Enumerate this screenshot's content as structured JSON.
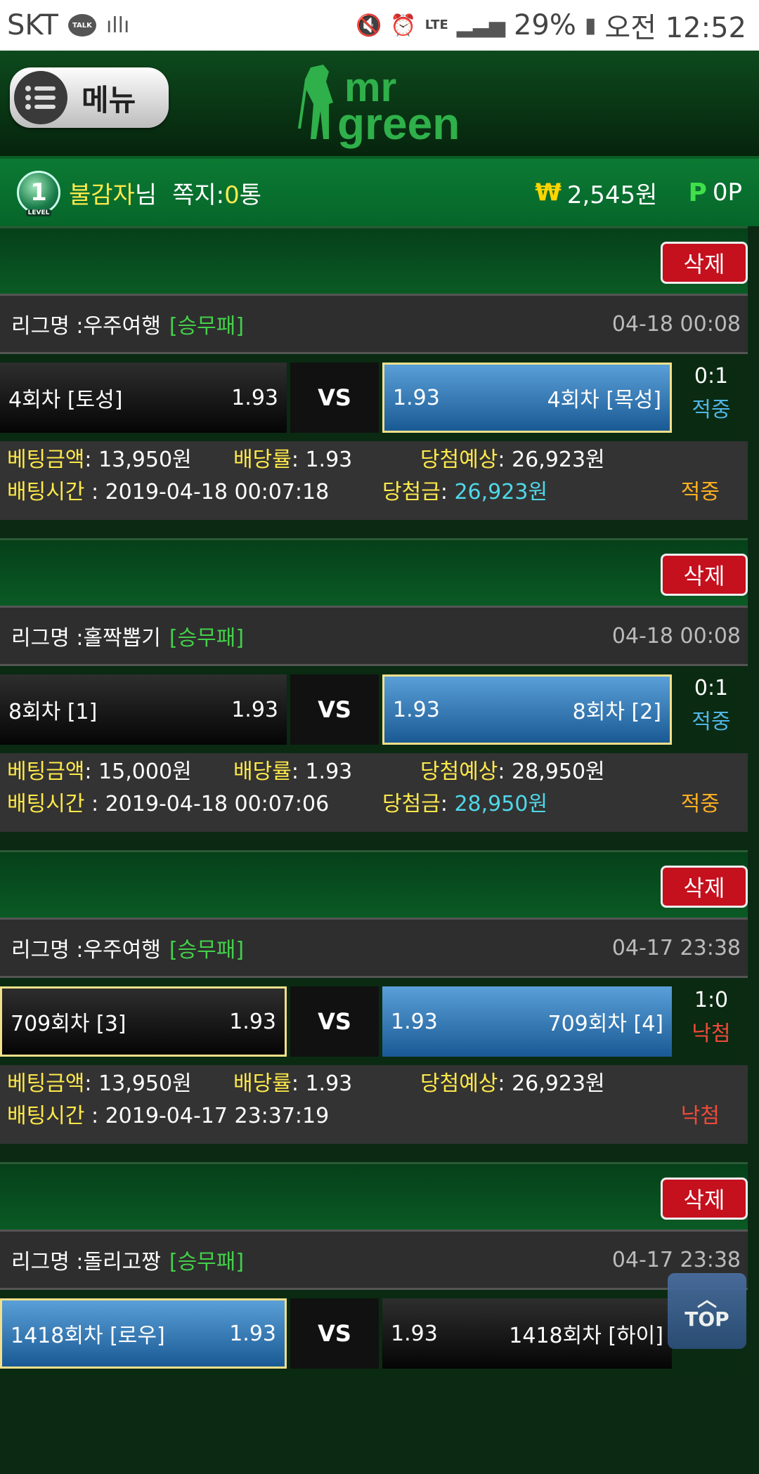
{
  "status_bar": {
    "carrier": "SKT",
    "talk_label": "TALK",
    "network": "LTE",
    "battery": "29%",
    "time": "오전 12:52"
  },
  "header": {
    "menu_label": "메뉴",
    "logo_text_1": "mr",
    "logo_text_2": "green"
  },
  "user": {
    "level": "1",
    "level_text": "LEVEL",
    "name": "불감자",
    "suffix": "님",
    "notes_label": "쪽지:",
    "notes_count": "0",
    "notes_unit": "통",
    "money": "2,545원",
    "won_symbol": "₩",
    "point_symbol": "P",
    "points": "0P"
  },
  "labels": {
    "delete": "삭제",
    "league_prefix": "리그명 : ",
    "vs": "VS",
    "bet_amount": "베팅금액",
    "odds": "배당률",
    "expected": "당첨예상",
    "bet_time": "배팅시간",
    "prize": "당첨금"
  },
  "bets": [
    {
      "league": "우주여행",
      "type": "[승무패]",
      "date": "04-18 00:08",
      "home": "4회차 [토성]",
      "home_odds": "1.93",
      "away": "4회차 [목성]",
      "away_odds": "1.93",
      "score": "0:1",
      "result": "적중",
      "amount": "13,950원",
      "odds": "1.93",
      "expected": "26,923원",
      "time": "2019-04-18 00:07:18",
      "prize": "26,923원",
      "status": "적중"
    },
    {
      "league": "홀짝뽑기",
      "type": "[승무패]",
      "date": "04-18 00:08",
      "home": "8회차 [1]",
      "home_odds": "1.93",
      "away": "8회차 [2]",
      "away_odds": "1.93",
      "score": "0:1",
      "result": "적중",
      "amount": "15,000원",
      "odds": "1.93",
      "expected": "28,950원",
      "time": "2019-04-18 00:07:06",
      "prize": "28,950원",
      "status": "적중"
    },
    {
      "league": "우주여행",
      "type": "[승무패]",
      "date": "04-17 23:38",
      "home": "709회차 [3]",
      "home_odds": "1.93",
      "away": "709회차 [4]",
      "away_odds": "1.93",
      "score": "1:0",
      "result": "낙첨",
      "amount": "13,950원",
      "odds": "1.93",
      "expected": "26,923원",
      "time": "2019-04-17 23:37:19",
      "status": "낙첨"
    },
    {
      "league": "돌리고짱",
      "type": "[승무패]",
      "date": "04-17 23:38",
      "home": "1418회차 [로우]",
      "home_odds": "1.93",
      "away": "1418회차 [하이]",
      "away_odds": "1.93"
    }
  ],
  "top_button": "TOP"
}
